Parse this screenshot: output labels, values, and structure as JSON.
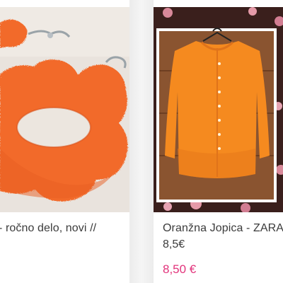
{
  "products": [
    {
      "title": "- ročno delo, novi //",
      "image_icon": "felt-flower-earrings-image"
    },
    {
      "title": "Oranžna Jopica - ZARA",
      "subtitle": "8,5€",
      "price": "8,50 €",
      "image_icon": "orange-cardigan-image"
    }
  ],
  "colors": {
    "price": "#e2337b",
    "text": "#3b3b3b",
    "felt_orange": "#f26a2b",
    "cardigan_orange": "#f58a1f"
  }
}
